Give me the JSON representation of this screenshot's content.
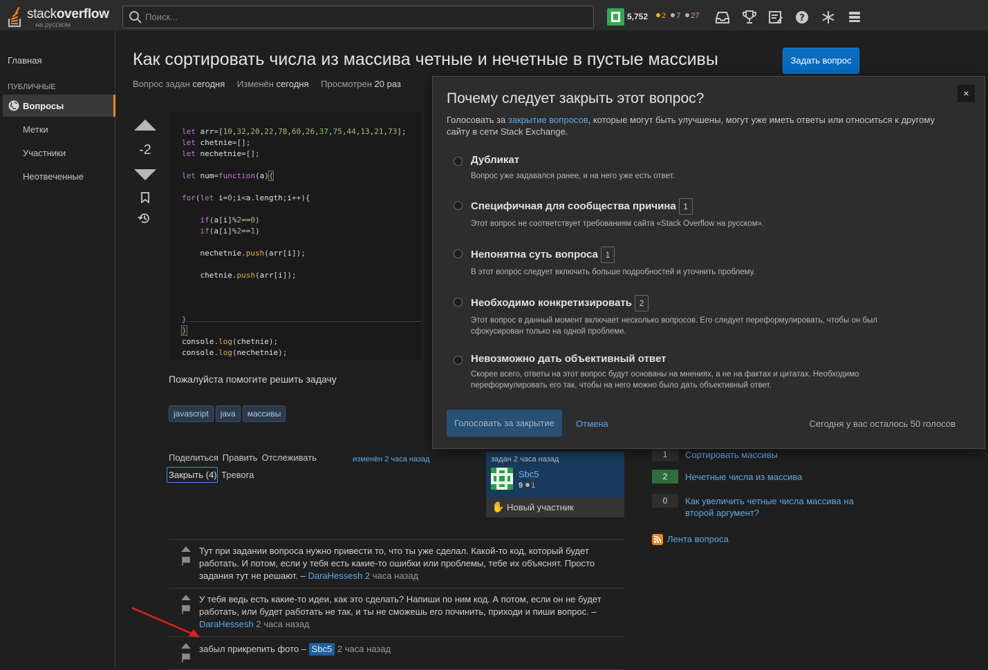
{
  "header": {
    "logo_main": "stack",
    "logo_bold": "overflow",
    "logo_sub": "на русском",
    "search_placeholder": "Поиск...",
    "reputation": "5,752",
    "badges": {
      "gold": "2",
      "silver": "7",
      "bronze": "27"
    },
    "icons": [
      "inbox-icon",
      "achievements-icon",
      "review-icon",
      "help-icon",
      "snowflake-icon",
      "site-switcher-icon"
    ]
  },
  "sidebar": {
    "home": "Главная",
    "section": "ПУБЛИЧНЫЕ",
    "questions": "Вопросы",
    "tags": "Метки",
    "users": "Участники",
    "unanswered": "Неотвеченные"
  },
  "question": {
    "title": "Как сортировать числа из массива четные и нечетные в пустые массивы",
    "ask_button": "Задать вопрос",
    "asked_label": "Вопрос задан",
    "asked_value": "сегодня",
    "modified_label": "Изменён",
    "modified_value": "сегодня",
    "viewed_label": "Просмотрен",
    "viewed_value": "20 раз",
    "score": "-2",
    "body": "Пожалуйста помогите решить задачу",
    "tags": [
      "javascript",
      "java",
      "массивы"
    ],
    "menu": {
      "share": "Поделиться",
      "edit": "Править",
      "follow": "Отслеживать",
      "close": "Закрыть (4)",
      "flag": "Тревога"
    },
    "edited": "изменён 2 часа назад",
    "owner": {
      "asked": "задан 2 часа назад",
      "name": "Sbc5",
      "rep": "9",
      "bronze": "1",
      "new_contributor": "Новый участник"
    }
  },
  "comments": [
    {
      "text": "Тут при задании вопроса нужно привести то, что ты уже сделал. Какой-то код, который будет работать. И потом, если у тебя есть какие-то ошибки или проблемы, тебе их объяснят. Просто задания тут не решают. –",
      "user": "DaraHessesh",
      "time": "2 часа назад"
    },
    {
      "text": "У тебя ведь есть какие-то идеи, как это сделать? Напиши по ним код. А потом, если он не будет работать, или будет работать не так, и ты не сможешь его починить, приходи и пиши вопрос. –",
      "user": "DaraHessesh",
      "time": "2 часа назад"
    },
    {
      "text": "забыл прикрепить фото –",
      "user": "Sbc5",
      "time": "2 часа назад"
    }
  ],
  "linked_questions": [
    {
      "count": "1",
      "title": "Сортировать массивы",
      "accepted": false
    },
    {
      "count": "2",
      "title": "Нечетные числа из массива",
      "accepted": true
    },
    {
      "count": "0",
      "title": "Как увеличить четные числа массива на второй аргумент?",
      "accepted": false
    }
  ],
  "feed": "Лента вопроса",
  "modal": {
    "title": "Почему следует закрыть этот вопрос?",
    "desc_before": "Голосовать за",
    "desc_link": "закрытие вопросов",
    "desc_after": ", которые могут быть улучшены, могут уже иметь ответы или относиться к другому сайту в сети Stack Exchange.",
    "close_icon": "×",
    "reasons": [
      {
        "title": "Дубликат",
        "count": "",
        "desc": "Вопрос уже задавался ранее, и на него уже есть ответ."
      },
      {
        "title": "Специфичная для сообщества причина",
        "count": "1",
        "desc": "Этот вопрос не соответствует требованиям сайта «Stack Overflow на русском»."
      },
      {
        "title": "Непонятна суть вопроса",
        "count": "1",
        "desc": "В этот вопрос следует включить больше подробностей и уточнить проблему."
      },
      {
        "title": "Необходимо конкретизировать",
        "count": "2",
        "desc": "Этот вопрос в данный момент включает несколько вопросов. Его следует переформулировать, чтобы он был сфокусирован только на одной проблеме."
      },
      {
        "title": "Невозможно дать объективный ответ",
        "count": "",
        "desc": "Скорее всего, ответы на этот вопрос будут основаны на мнениях, а не на фактах и цитатах. Необходимо переформулировать его так, чтобы на него можно было дать объективный ответ."
      }
    ],
    "vote_button": "Голосовать за закрытие",
    "cancel": "Отмена",
    "votes_left": "Сегодня у вас осталось 50 голосов"
  },
  "colors": {
    "accent": "#f48225",
    "link": "#5fa8e6",
    "primary_button": "#0a6bbf",
    "annotation": "#e0221b"
  }
}
